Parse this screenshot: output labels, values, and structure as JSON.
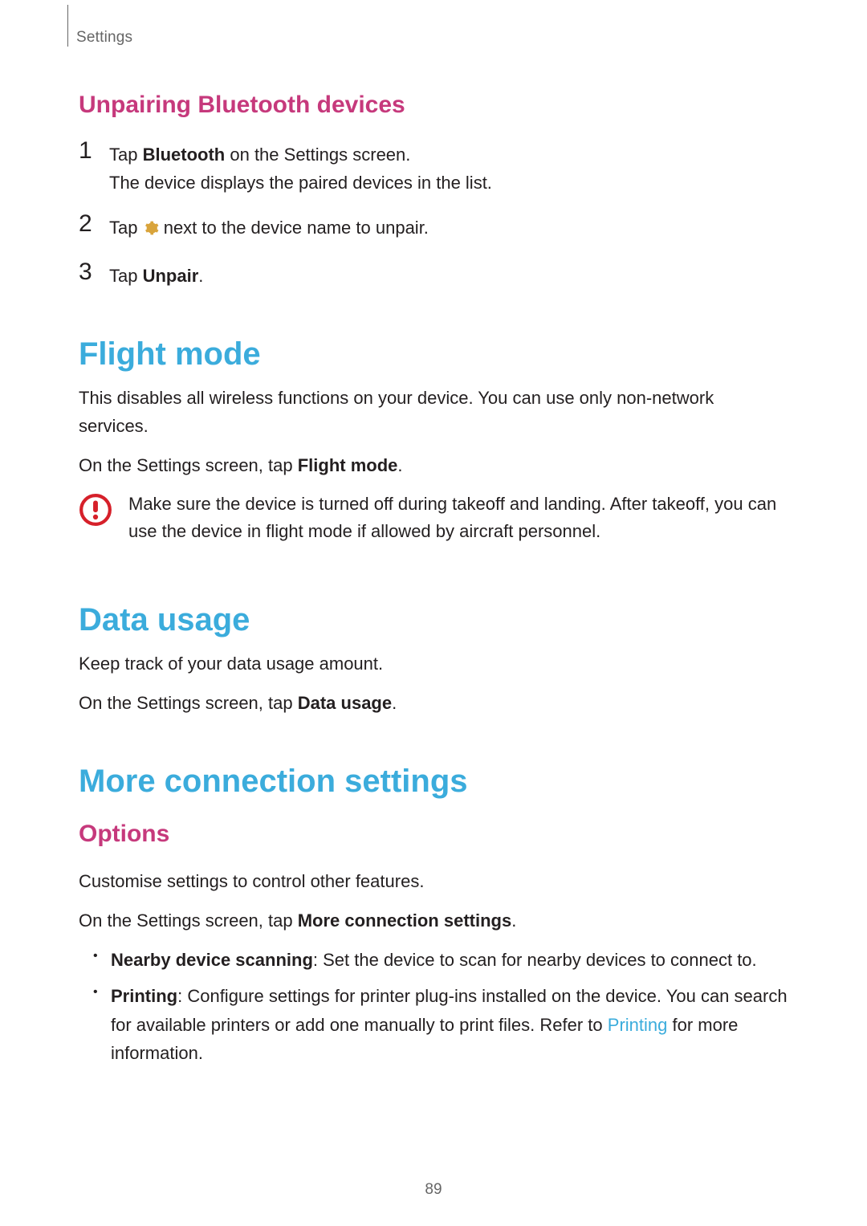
{
  "header": {
    "section": "Settings"
  },
  "unpair": {
    "heading": "Unpairing Bluetooth devices",
    "step1a": "Tap ",
    "step1b": "Bluetooth",
    "step1c": " on the Settings screen.",
    "step1d": "The device displays the paired devices in the list.",
    "step2a": "Tap ",
    "step2b": " next to the device name to unpair.",
    "step3a": "Tap ",
    "step3b": "Unpair",
    "step3c": "."
  },
  "flight": {
    "heading": "Flight mode",
    "p1": "This disables all wireless functions on your device. You can use only non-network services.",
    "p2a": "On the Settings screen, tap ",
    "p2b": "Flight mode",
    "p2c": ".",
    "notice": "Make sure the device is turned off during takeoff and landing. After takeoff, you can use the device in flight mode if allowed by aircraft personnel."
  },
  "datausage": {
    "heading": "Data usage",
    "p1": "Keep track of your data usage amount.",
    "p2a": "On the Settings screen, tap ",
    "p2b": "Data usage",
    "p2c": "."
  },
  "moreconn": {
    "heading": "More connection settings",
    "options_heading": "Options",
    "p1": "Customise settings to control other features.",
    "p2a": "On the Settings screen, tap ",
    "p2b": "More connection settings",
    "p2c": ".",
    "li1a": "Nearby device scanning",
    "li1b": ": Set the device to scan for nearby devices to connect to.",
    "li2a": "Printing",
    "li2b": ": Configure settings for printer plug-ins installed on the device. You can search for available printers or add one manually to print files. Refer to ",
    "li2c": "Printing",
    "li2d": " for more information."
  },
  "page_number": "89"
}
